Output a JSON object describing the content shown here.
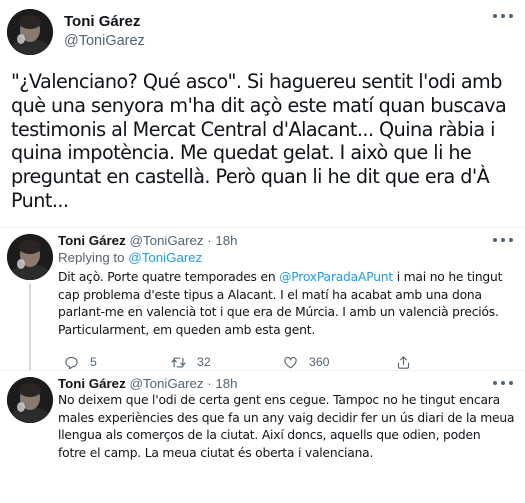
{
  "main_tweet": {
    "author_name": "Toni Gárez",
    "author_handle": "@ToniGarez",
    "text_lines": [
      "\"¿Valenciano? Qué asco\". Si haguereu sentit l'odi amb",
      "què una senyora m'ha dit açò este matí quan buscava",
      "testimonis al Mercat Central d'Alacant... Quina ràbia i",
      "quina impotència. Me quedat gelat. I això que li he",
      "preguntat en castellà. Però quan li he dit que era d'À",
      "Punt..."
    ]
  },
  "replies": [
    {
      "author_name": "Toni Gárez",
      "author_handle": "@ToniGarez",
      "separator": "·",
      "time": "18h",
      "replying_to_label": "Replying to",
      "replying_to_handle": "@ToniGarez",
      "text_lines": [
        "Dit açò. Porte quatre temporades en ",
        "cap problema d'este tipus a Alacant. I el matí ha acabat amb una dona",
        "parlant-me en valencià tot i que era de Múrcia. I amb un valencià preciós.",
        "Particularment, em queden amb esta gent."
      ],
      "mention": "@ProxParadaAPunt",
      "line1_tail": " i mai no he tingut",
      "reply_count": "5",
      "retweet_count": "32",
      "like_count": "360"
    },
    {
      "author_name": "Toni Gárez",
      "author_handle": "@ToniGarez",
      "separator": "·",
      "time": "18h",
      "text_lines": [
        "No deixem que l'odi de certa gent ens cegue. Tampoc no he tingut encara",
        "males experiències des que fa un any vaig decidir fer un ús diari de la meua",
        "llengua als comerços de la ciutat. Així doncs, aquells que odien, poden",
        "fotre el camp. La meua ciutat és oberta i valenciana."
      ]
    }
  ],
  "icons": {
    "more": "more-horizontal-icon",
    "reply": "reply-bubble-icon",
    "retweet": "retweet-icon",
    "like": "heart-icon",
    "share": "share-icon"
  },
  "colors": {
    "link": "#1d9bf0",
    "secondary_text": "#536471",
    "divider": "#eff3f4"
  }
}
